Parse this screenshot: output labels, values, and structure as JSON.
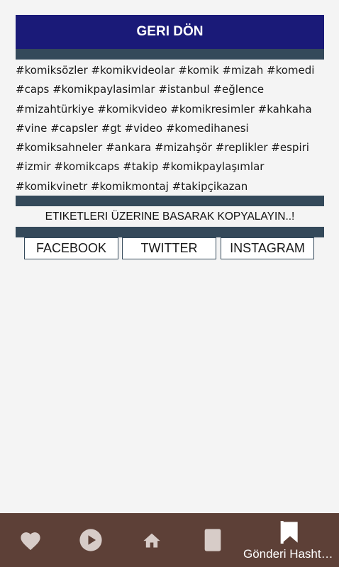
{
  "header": {
    "back_label": "GERI DÖN"
  },
  "hashtags": {
    "text": "#komiksözler #komikvideolar #komik #mizah #komedi #caps #komikpaylasimlar #istanbul #eğlence #mizahtürkiye #komikvideo #komikresimler #kahkaha #vine #capsler #gt #video #komedihanesi #komiksahneler #ankara #mizahşör #replikler #espiri #izmir #komikcaps #takip #komikpaylaşımlar #komikvinetr #komikmontaj #takipçikazan"
  },
  "hint": {
    "text": "ETIKETLERI ÜZERINE BASARAK KOPYALAYIN..!"
  },
  "social": {
    "facebook": "FACEBOOK",
    "twitter": "TWITTER",
    "instagram": "INSTAGRAM"
  },
  "bottom_nav": {
    "items": [
      {
        "icon": "heart-icon"
      },
      {
        "icon": "play-icon"
      },
      {
        "icon": "home-icon"
      },
      {
        "icon": "book-icon"
      },
      {
        "icon": "bookmark-icon",
        "label": "Gönderi Hashtagleri"
      }
    ]
  },
  "colors": {
    "header_bg": "#1a1a78",
    "bar_bg": "#34495a",
    "page_bg": "#f4f4f4",
    "nav_bg": "#5d4037",
    "nav_icon": "#d7ccc8"
  }
}
